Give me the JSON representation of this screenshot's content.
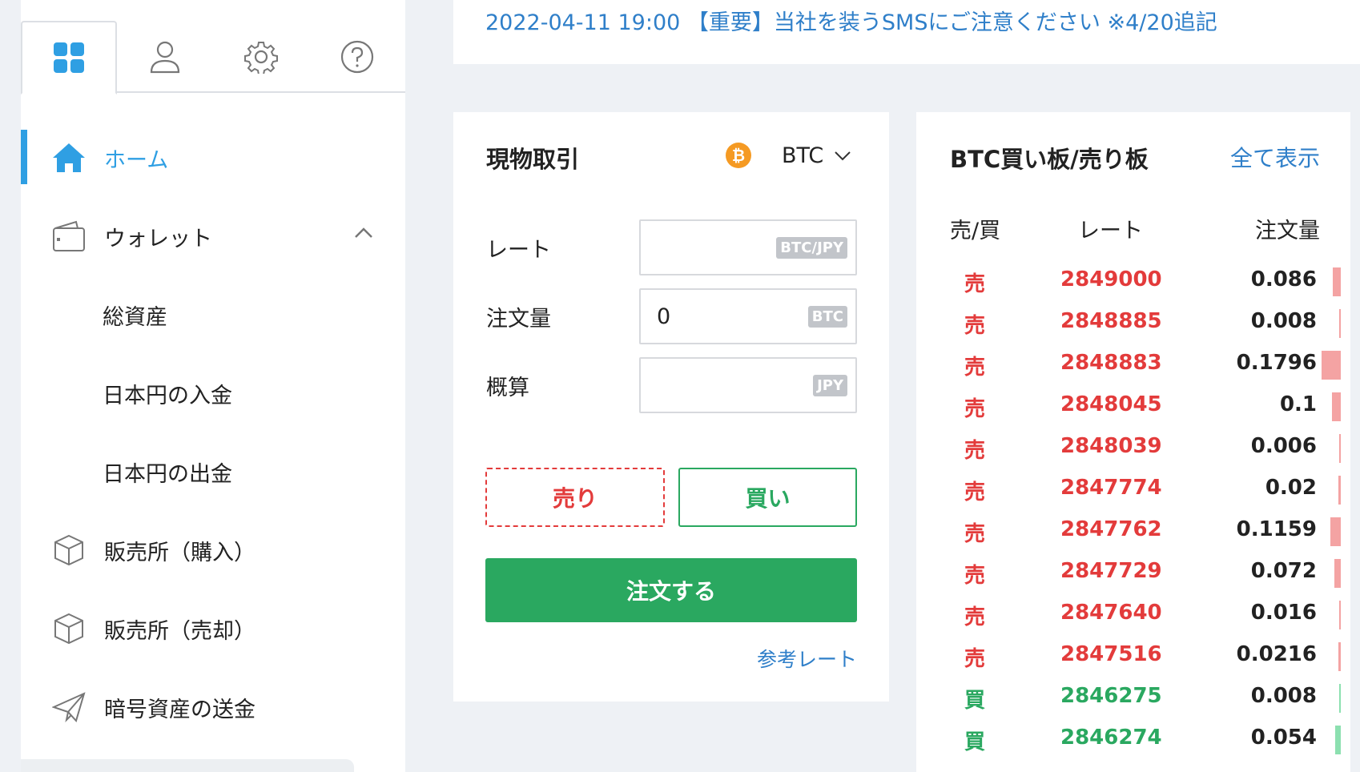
{
  "announcement": {
    "text": "2022-04-11 19:00 【重要】当社を装うSMSにご注意ください ※4/20追記"
  },
  "sidebar": {
    "tabs": [
      {
        "icon": "grid-icon"
      },
      {
        "icon": "user-icon"
      },
      {
        "icon": "gear-icon"
      },
      {
        "icon": "help-icon"
      }
    ],
    "items": [
      {
        "label": "ホーム",
        "icon": "home-icon",
        "active": true
      },
      {
        "label": "ウォレット",
        "icon": "wallet-icon",
        "expanded": true
      },
      {
        "label": "総資産",
        "sub": true
      },
      {
        "label": "日本円の入金",
        "sub": true
      },
      {
        "label": "日本円の出金",
        "sub": true
      },
      {
        "label": "販売所（購入）",
        "icon": "box-icon"
      },
      {
        "label": "販売所（売却）",
        "icon": "box-icon"
      },
      {
        "label": "暗号資産の送金",
        "icon": "send-icon"
      }
    ]
  },
  "trade": {
    "title": "現物取引",
    "coin": "BTC",
    "coin_symbol": "₿",
    "rate_label": "レート",
    "rate_unit": "BTC/JPY",
    "rate_value": "",
    "amount_label": "注文量",
    "amount_unit": "BTC",
    "amount_value": "0",
    "estimate_label": "概算",
    "estimate_unit": "JPY",
    "estimate_value": "",
    "sell_label": "売り",
    "buy_label": "買い",
    "order_label": "注文する",
    "ref_rate_label": "参考レート"
  },
  "orderbook": {
    "title": "BTC買い板/売り板",
    "view_all": "全て表示",
    "col_side": "売/買",
    "col_rate": "レート",
    "col_amount": "注文量",
    "rows": [
      {
        "side": "売",
        "type": "sell",
        "rate": "2849000",
        "amount": "0.086",
        "depth": 0.4
      },
      {
        "side": "売",
        "type": "sell",
        "rate": "2848885",
        "amount": "0.008",
        "depth": 0.08
      },
      {
        "side": "売",
        "type": "sell",
        "rate": "2848883",
        "amount": "0.1796",
        "depth": 1.0
      },
      {
        "side": "売",
        "type": "sell",
        "rate": "2848045",
        "amount": "0.1",
        "depth": 0.45
      },
      {
        "side": "売",
        "type": "sell",
        "rate": "2848039",
        "amount": "0.006",
        "depth": 0.06
      },
      {
        "side": "売",
        "type": "sell",
        "rate": "2847774",
        "amount": "0.02",
        "depth": 0.12
      },
      {
        "side": "売",
        "type": "sell",
        "rate": "2847762",
        "amount": "0.1159",
        "depth": 0.55
      },
      {
        "side": "売",
        "type": "sell",
        "rate": "2847729",
        "amount": "0.072",
        "depth": 0.35
      },
      {
        "side": "売",
        "type": "sell",
        "rate": "2847640",
        "amount": "0.016",
        "depth": 0.1
      },
      {
        "side": "売",
        "type": "sell",
        "rate": "2847516",
        "amount": "0.0216",
        "depth": 0.12
      },
      {
        "side": "買",
        "type": "buy",
        "rate": "2846275",
        "amount": "0.008",
        "depth": 0.08
      },
      {
        "side": "買",
        "type": "buy",
        "rate": "2846274",
        "amount": "0.054",
        "depth": 0.3
      }
    ]
  },
  "colors": {
    "accent": "#2f9fe3",
    "sell": "#e33b3b",
    "buy": "#2aa860",
    "link": "#2f7fc9"
  }
}
